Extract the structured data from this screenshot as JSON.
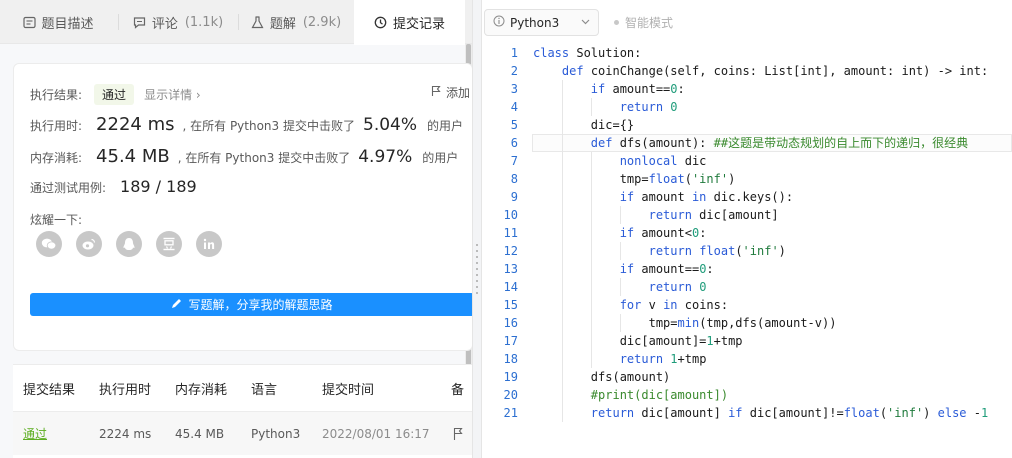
{
  "tabs": [
    {
      "label": "题目描述",
      "count": "",
      "icon": "description-icon"
    },
    {
      "label": "评论",
      "count": "(1.1k)",
      "icon": "comment-icon"
    },
    {
      "label": "题解",
      "count": "(2.9k)",
      "icon": "flask-icon"
    },
    {
      "label": "提交记录",
      "count": "",
      "icon": "clock-icon",
      "active": true
    }
  ],
  "result": {
    "status_label": "执行结果:",
    "status_value": "通过",
    "detail_link": "显示详情 ›",
    "add_note": "添加",
    "runtime_label": "执行用时:",
    "runtime_value": "2224 ms",
    "runtime_text": ", 在所有 Python3 提交中击败了",
    "runtime_pct": "5.04%",
    "runtime_suffix": "的用户",
    "memory_label": "内存消耗:",
    "memory_value": "45.4 MB",
    "memory_text": ", 在所有 Python3 提交中击败了",
    "memory_pct": "4.97%",
    "memory_suffix": "的用户",
    "tests_label": "通过测试用例:",
    "tests_value": "189 / 189",
    "share_label": "炫耀一下:",
    "share_icons": [
      "wechat-icon",
      "weibo-icon",
      "qq-icon",
      "douban-icon",
      "linkedin-icon"
    ],
    "write_button": "写题解，分享我的解题思路"
  },
  "submissions": {
    "headers": [
      "提交结果",
      "执行用时",
      "内存消耗",
      "语言",
      "提交时间",
      "备"
    ],
    "rows": [
      {
        "result": "通过",
        "runtime": "2224 ms",
        "memory": "45.4 MB",
        "language": "Python3",
        "time": "2022/08/01 16:17"
      }
    ]
  },
  "editor": {
    "language": "Python3",
    "smart_mode": "智能模式"
  },
  "code_lines": [
    "class Solution:",
    "    def coinChange(self, coins: List[int], amount: int) -> int:",
    "        if amount==0:",
    "            return 0",
    "        dic={}",
    "        def dfs(amount): ##这题是带动态规划的自上而下的递归，很经典",
    "            nonlocal dic",
    "            tmp=float('inf')",
    "            if amount in dic.keys():",
    "                return dic[amount]",
    "            if amount<0:",
    "                return float('inf')",
    "            if amount==0:",
    "                return 0",
    "            for v in coins:",
    "                tmp=min(tmp,dfs(amount-v))",
    "            dic[amount]=1+tmp",
    "            return 1+tmp",
    "        dfs(amount)",
    "        #print(dic[amount])",
    "        return dic[amount] if dic[amount]!=float('inf') else -1"
  ]
}
